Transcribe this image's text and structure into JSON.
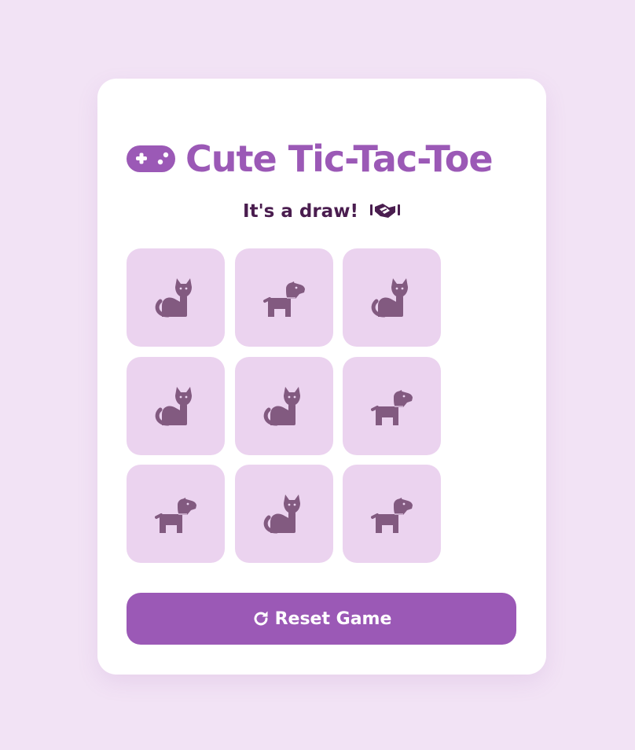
{
  "app": {
    "title": "Cute Tic-Tac-Toe",
    "title_icon": "gamepad-icon"
  },
  "status": {
    "text": "It's a draw!",
    "emoji_icon": "handshake-icon"
  },
  "board": {
    "cells": [
      {
        "piece": "cat"
      },
      {
        "piece": "dog"
      },
      {
        "piece": "cat"
      },
      {
        "piece": "cat"
      },
      {
        "piece": "cat"
      },
      {
        "piece": "dog"
      },
      {
        "piece": "dog"
      },
      {
        "piece": "cat"
      },
      {
        "piece": "dog"
      }
    ]
  },
  "reset": {
    "label": "Reset Game",
    "icon": "rotate-icon"
  },
  "colors": {
    "background": "#f2e3f5",
    "card": "#ffffff",
    "accent": "#9b59b6",
    "cell": "#ebd3ef",
    "piece": "#825a80",
    "status_text": "#4a1d4f"
  }
}
